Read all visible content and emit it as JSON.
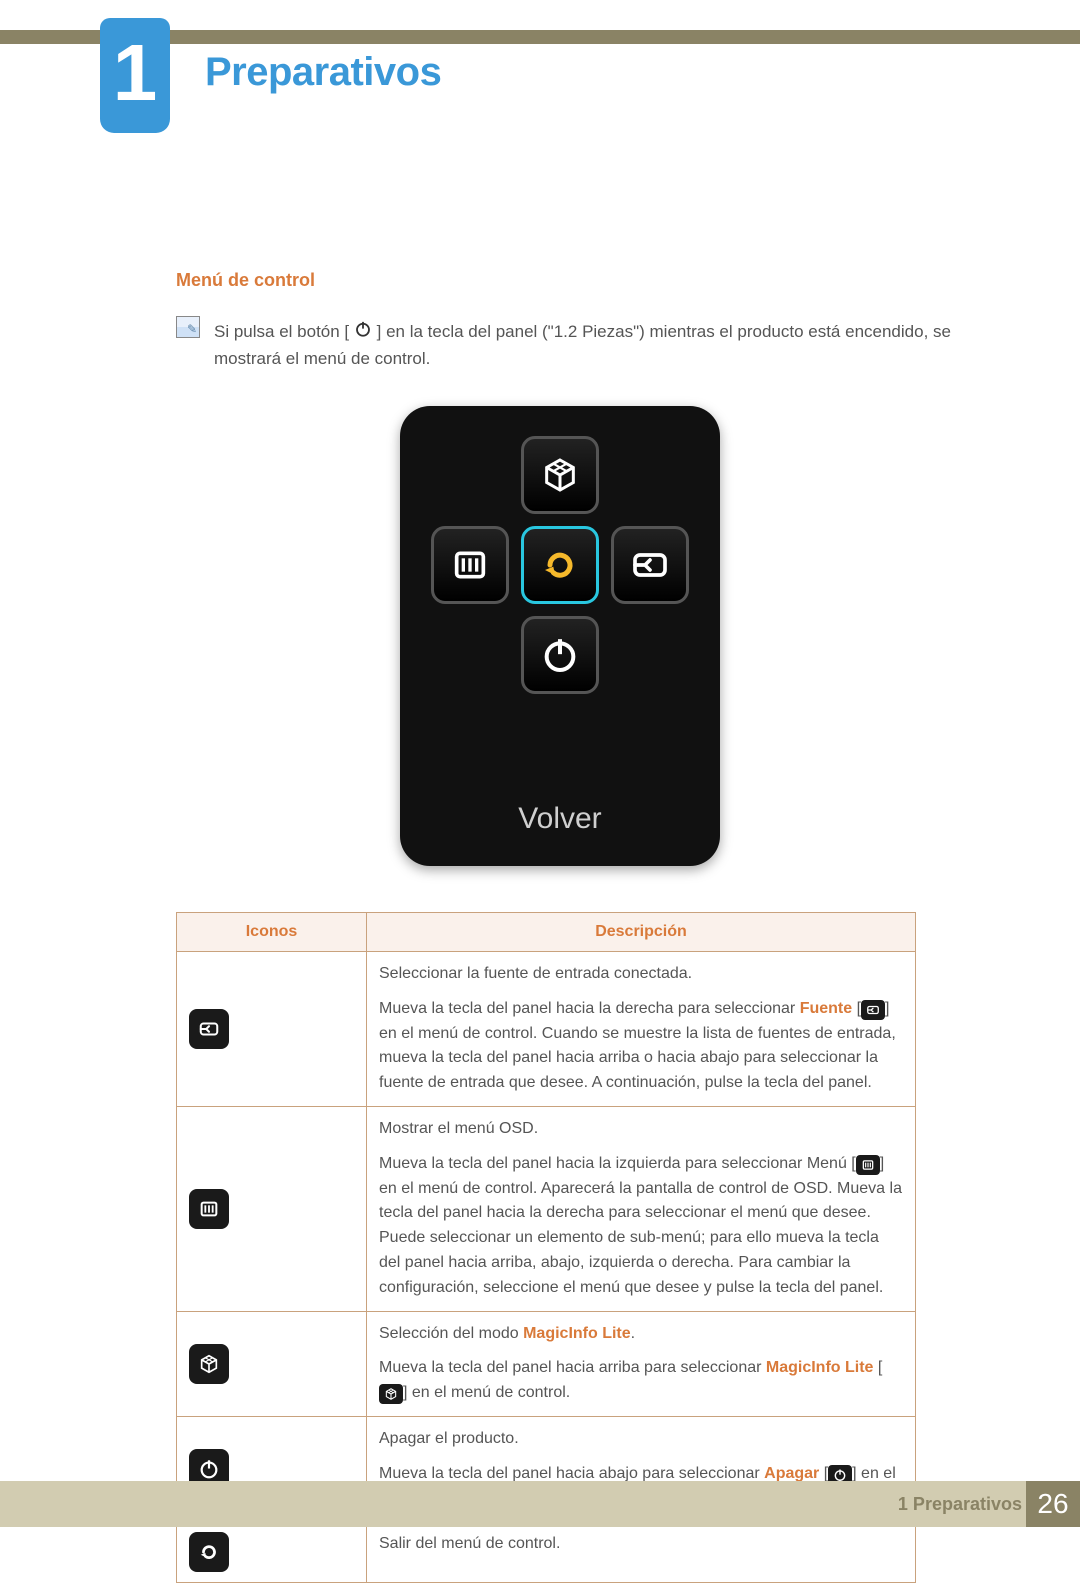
{
  "chapter_number": "1",
  "page_title": "Preparativos",
  "section_title": "Menú de control",
  "note_paragraph_a": "Si pulsa el botón [",
  "note_paragraph_b": "] en la tecla del panel (\"1.2 Piezas\") mientras el producto está encendido, se mostrará el menú de control.",
  "device_label": "Volver",
  "table": {
    "header_icons": "Iconos",
    "header_desc": "Descripción",
    "rows": [
      {
        "p1": "Seleccionar la fuente de entrada conectada.",
        "p2a": "Mueva la tecla del panel hacia la derecha para seleccionar ",
        "hl": "Fuente",
        "p2b": " [",
        "p2c": "] en el menú de control. Cuando se muestre la lista de fuentes de entrada, mueva la tecla del panel hacia arriba o hacia abajo para seleccionar la fuente de entrada que desee. A continuación, pulse la tecla del panel."
      },
      {
        "p1": "Mostrar el menú OSD.",
        "p2a": "Mueva la tecla del panel hacia la izquierda para seleccionar Menú [",
        "p2b": "] en el menú de control. Aparecerá la pantalla de control de OSD. Mueva la tecla del panel hacia la derecha para seleccionar el menú que desee. Puede seleccionar un elemento de sub-menú; para ello mueva la tecla del panel hacia arriba, abajo, izquierda o derecha. Para cambiar la configuración, seleccione el menú que desee y pulse la tecla del panel."
      },
      {
        "p1a": "Selección del modo ",
        "hl1": "MagicInfo Lite",
        "p1b": ".",
        "p2a": "Mueva la tecla del panel hacia arriba para seleccionar ",
        "hl2": "MagicInfo Lite",
        "p2b": " [",
        "p2c": "] en el menú de control."
      },
      {
        "p1": "Apagar el producto.",
        "p2a": "Mueva la tecla del panel hacia abajo para seleccionar ",
        "hl": "Apagar",
        "p2b": " [",
        "p2c": "] en el menú de control. A continuación, pulse la tecla del panel."
      },
      {
        "p1": "Salir del menú de control."
      }
    ]
  },
  "footer_label": "1 Preparativos",
  "footer_page": "26"
}
